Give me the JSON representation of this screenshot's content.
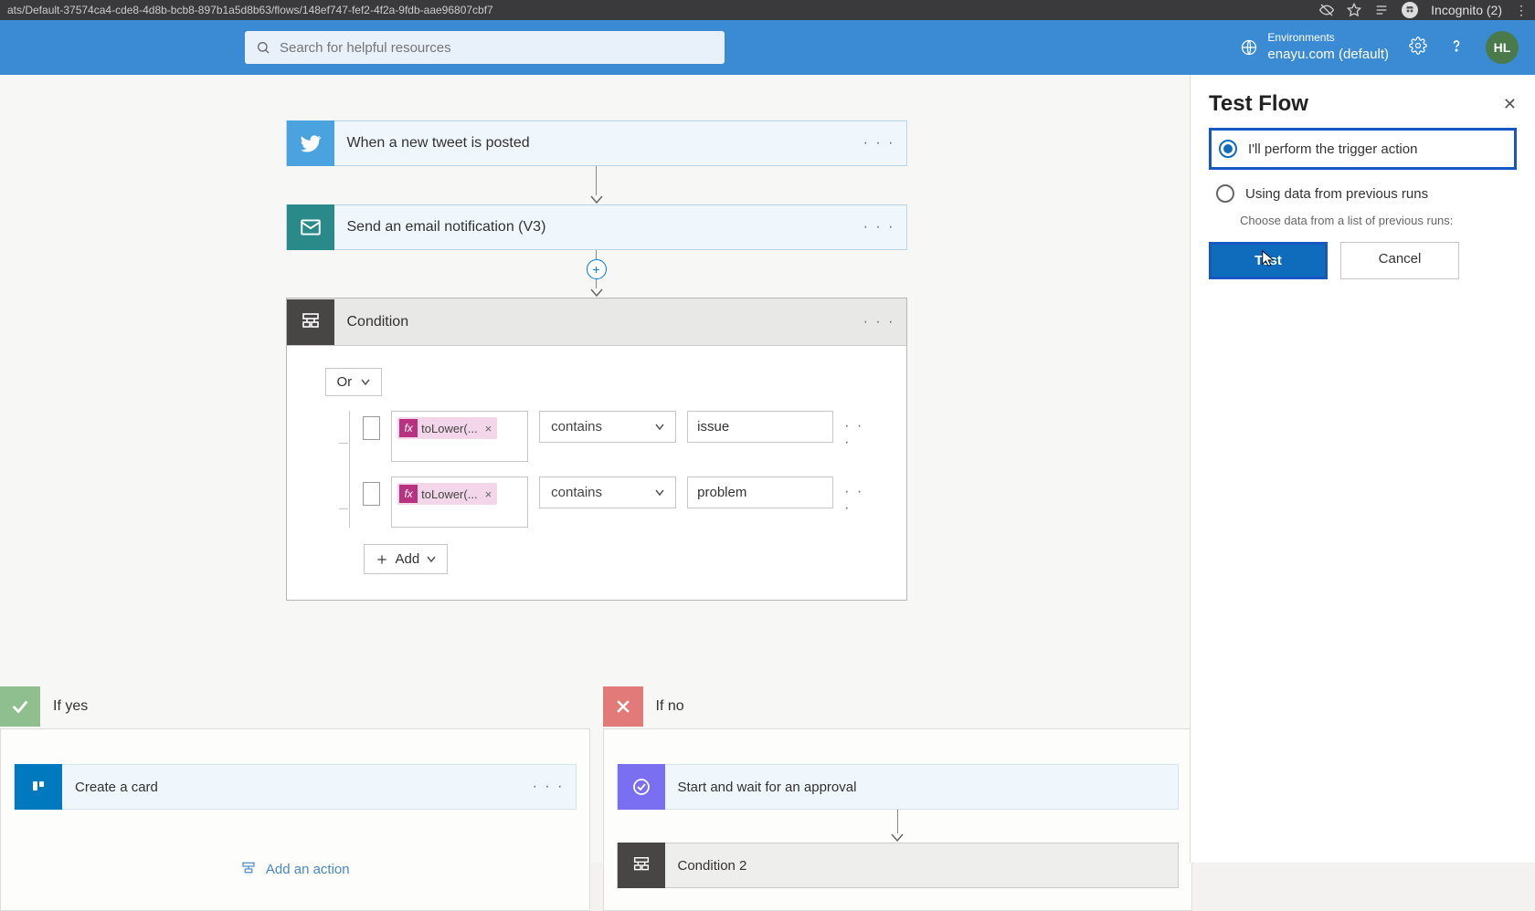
{
  "browser": {
    "url": "ats/Default-37574ca4-cde8-4d8b-bcb8-897b1a5d8b63/flows/148ef747-fef2-4f2a-9fdb-aae96807cbf7",
    "incognito_label": "Incognito (2)"
  },
  "header": {
    "search_placeholder": "Search for helpful resources",
    "env_label": "Environments",
    "env_name": "enayu.com (default)",
    "user_initials": "HL"
  },
  "flow": {
    "trigger": {
      "title": "When a new tweet is posted"
    },
    "action1": {
      "title": "Send an email notification (V3)"
    },
    "condition": {
      "title": "Condition",
      "logic": "Or",
      "rows": [
        {
          "token": "toLower(...",
          "operator": "contains",
          "value": "issue"
        },
        {
          "token": "toLower(...",
          "operator": "contains",
          "value": "problem"
        }
      ],
      "add_label": "Add"
    },
    "yes": {
      "title": "If yes",
      "step": "Create a card",
      "add_action": "Add an action"
    },
    "no": {
      "title": "If no",
      "step1": "Start and wait for an approval",
      "step2": "Condition 2"
    }
  },
  "panel": {
    "title": "Test Flow",
    "opt1": "I'll perform the trigger action",
    "opt2": "Using data from previous runs",
    "opt2_sub": "Choose data from a list of previous runs:",
    "test_btn": "Test",
    "cancel_btn": "Cancel"
  }
}
